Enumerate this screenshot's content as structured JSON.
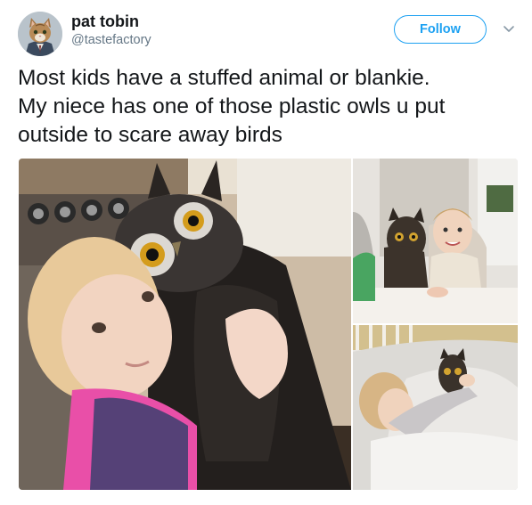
{
  "author": {
    "name": "pat tobin",
    "handle": "@tastefactory"
  },
  "actions": {
    "follow_label": "Follow"
  },
  "tweet": {
    "text": "Most kids have a stuffed animal or blankie.\nMy niece has one of those plastic owls u put\noutside to scare away birds"
  },
  "icons": {
    "avatar": "cat-avatar-icon",
    "more": "chevron-down-icon"
  },
  "colors": {
    "accent": "#1da1f2",
    "text": "#14171a",
    "secondary_text": "#657786"
  }
}
